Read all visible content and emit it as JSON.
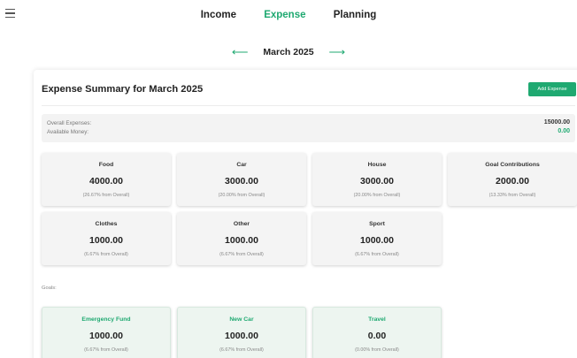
{
  "nav": {
    "items": [
      "Income",
      "Expense",
      "Planning"
    ],
    "active": 1
  },
  "month": {
    "prev_arrow": "⟵",
    "label": "March 2025",
    "next_arrow": "⟶"
  },
  "summary": {
    "title": "Expense Summary for March 2025",
    "add_button": "Add Expense",
    "overall_label": "Overall Expenses:",
    "overall_value": "15000.00",
    "available_label": "Available Money:",
    "available_value": "0.00"
  },
  "categories": [
    {
      "name": "Food",
      "amount": "4000.00",
      "pct": "(26.67% from Overall)"
    },
    {
      "name": "Car",
      "amount": "3000.00",
      "pct": "(20.00% from Overall)"
    },
    {
      "name": "House",
      "amount": "3000.00",
      "pct": "(20.00% from Overall)"
    },
    {
      "name": "Goal Contributions",
      "amount": "2000.00",
      "pct": "(13.33% from Overall)"
    },
    {
      "name": "Clothes",
      "amount": "1000.00",
      "pct": "(6.67% from Overall)"
    },
    {
      "name": "Other",
      "amount": "1000.00",
      "pct": "(6.67% from Overall)"
    },
    {
      "name": "Sport",
      "amount": "1000.00",
      "pct": "(6.67% from Overall)"
    }
  ],
  "goals_label": "Goals:",
  "goals": [
    {
      "name": "Emergency Fund",
      "amount": "1000.00",
      "pct": "(6.67% from Overall)"
    },
    {
      "name": "New Car",
      "amount": "1000.00",
      "pct": "(6.67% from Overall)"
    },
    {
      "name": "Travel",
      "amount": "0.00",
      "pct": "(0.00% from Overall)"
    }
  ],
  "colors": {
    "accent": "#1fa971",
    "card_bg": "#f4f4f4",
    "goal_card_bg": "#edf5f0"
  }
}
